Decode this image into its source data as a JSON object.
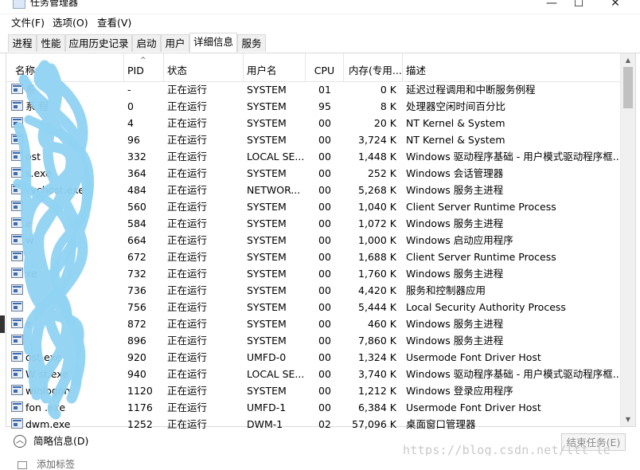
{
  "window": {
    "title": "任务管理器",
    "minimize_glyph": "—",
    "maximize_glyph": "☐",
    "close_glyph": "✕"
  },
  "menu": [
    "文件(F)",
    "选项(O)",
    "查看(V)"
  ],
  "tabs": [
    "进程",
    "性能",
    "应用历史记录",
    "启动",
    "用户",
    "详细信息",
    "服务"
  ],
  "active_tab": "详细信息",
  "columns": [
    "名称",
    "PID",
    "状态",
    "用户名",
    "CPU",
    "内存(专用...",
    "描述"
  ],
  "sort_indicator": "^",
  "rows": [
    {
      "name": "系",
      "pid": "-",
      "status": "正在运行",
      "user": "SYSTEM",
      "cpu": "01",
      "mem": "0 K",
      "desc": "延迟过程调用和中断服务例程"
    },
    {
      "name": "系          程",
      "pid": "0",
      "status": "正在运行",
      "user": "SYSTEM",
      "cpu": "95",
      "mem": "8 K",
      "desc": "处理器空闲时间百分比"
    },
    {
      "name": "",
      "pid": "4",
      "status": "正在运行",
      "user": "SYSTEM",
      "cpu": "00",
      "mem": "20 K",
      "desc": "NT Kernel & System"
    },
    {
      "name": "",
      "pid": "96",
      "status": "正在运行",
      "user": "SYSTEM",
      "cpu": "00",
      "mem": "3,724 K",
      "desc": "NT Kernel & System"
    },
    {
      "name": "           ost",
      "pid": "332",
      "status": "正在运行",
      "user": "LOCAL SE...",
      "cpu": "00",
      "mem": "1,448 K",
      "desc": "Windows 驱动程序基础 - 用户模式驱动程序框..."
    },
    {
      "name": "      s.exe",
      "pid": "364",
      "status": "正在运行",
      "user": "SYSTEM",
      "cpu": "00",
      "mem": "252 K",
      "desc": "Windows 会话管理器"
    },
    {
      "name": "  svchost.exe",
      "pid": "484",
      "status": "正在运行",
      "user": "NETWOR...",
      "cpu": "00",
      "mem": "5,268 K",
      "desc": "Windows 服务主进程"
    },
    {
      "name": "",
      "pid": "560",
      "status": "正在运行",
      "user": "SYSTEM",
      "cpu": "00",
      "mem": "1,040 K",
      "desc": "Client Server Runtime Process"
    },
    {
      "name": "          e",
      "pid": "584",
      "status": "正在运行",
      "user": "SYSTEM",
      "cpu": "00",
      "mem": "1,072 K",
      "desc": "Windows 服务主进程"
    },
    {
      "name": "  w",
      "pid": "664",
      "status": "正在运行",
      "user": "SYSTEM",
      "cpu": "00",
      "mem": "1,000 K",
      "desc": "Windows 启动应用程序"
    },
    {
      "name": "",
      "pid": "672",
      "status": "正在运行",
      "user": "SYSTEM",
      "cpu": "00",
      "mem": "1,688 K",
      "desc": "Client Server Runtime Process"
    },
    {
      "name": "           xe",
      "pid": "732",
      "status": "正在运行",
      "user": "SYSTEM",
      "cpu": "00",
      "mem": "1,760 K",
      "desc": "Windows 服务主进程"
    },
    {
      "name": "",
      "pid": "736",
      "status": "正在运行",
      "user": "SYSTEM",
      "cpu": "00",
      "mem": "4,420 K",
      "desc": "服务和控制器应用"
    },
    {
      "name": "",
      "pid": "756",
      "status": "正在运行",
      "user": "SYSTEM",
      "cpu": "00",
      "mem": "5,444 K",
      "desc": "Local Security Authority Process"
    },
    {
      "name": "          e",
      "pid": "872",
      "status": "正在运行",
      "user": "SYSTEM",
      "cpu": "00",
      "mem": "460 K",
      "desc": "Windows 服务主进程"
    },
    {
      "name": "",
      "pid": "896",
      "status": "正在运行",
      "user": "SYSTEM",
      "cpu": "00",
      "mem": "7,860 K",
      "desc": "Windows 服务主进程"
    },
    {
      "name": "         ost.exe",
      "pid": "920",
      "status": "正在运行",
      "user": "UMFD-0",
      "cpu": "00",
      "mem": "1,324 K",
      "desc": "Usermode Font Driver Host"
    },
    {
      "name": "W        st.exe",
      "pid": "940",
      "status": "正在运行",
      "user": "LOCAL SE...",
      "cpu": "00",
      "mem": "3,740 K",
      "desc": "Windows 驱动程序基础 - 用户模式驱动程序框..."
    },
    {
      "name": "winlogon",
      "pid": "1120",
      "status": "正在运行",
      "user": "SYSTEM",
      "cpu": "00",
      "mem": "1,212 K",
      "desc": "Windows 登录应用程序"
    },
    {
      "name": "fon       .exe",
      "pid": "1176",
      "status": "正在运行",
      "user": "UMFD-1",
      "cpu": "00",
      "mem": "6,384 K",
      "desc": "Usermode Font Driver Host"
    },
    {
      "name": "dwm.exe",
      "pid": "1252",
      "status": "正在运行",
      "user": "DWM-1",
      "cpu": "02",
      "mem": "57,096 K",
      "desc": "桌面窗口管理器"
    }
  ],
  "scroll_up_glyph": "▲",
  "scroll_down_glyph": "▼",
  "footer": {
    "fewer_icon_glyph": "︿",
    "fewer_details": "简略信息(D)",
    "end_task": "结束任务(E)"
  },
  "watermark": "https://blog.csdn.net/ltt_le",
  "bottom_strip": "添加标签",
  "colors": {
    "scribble": "#8fd3f2",
    "tab_border": "#d9d9d9",
    "disabled_text": "#8a8a8a"
  },
  "icons": [
    "app-icon",
    "process-icon",
    "chevron-up-icon",
    "sort-up-icon"
  ]
}
